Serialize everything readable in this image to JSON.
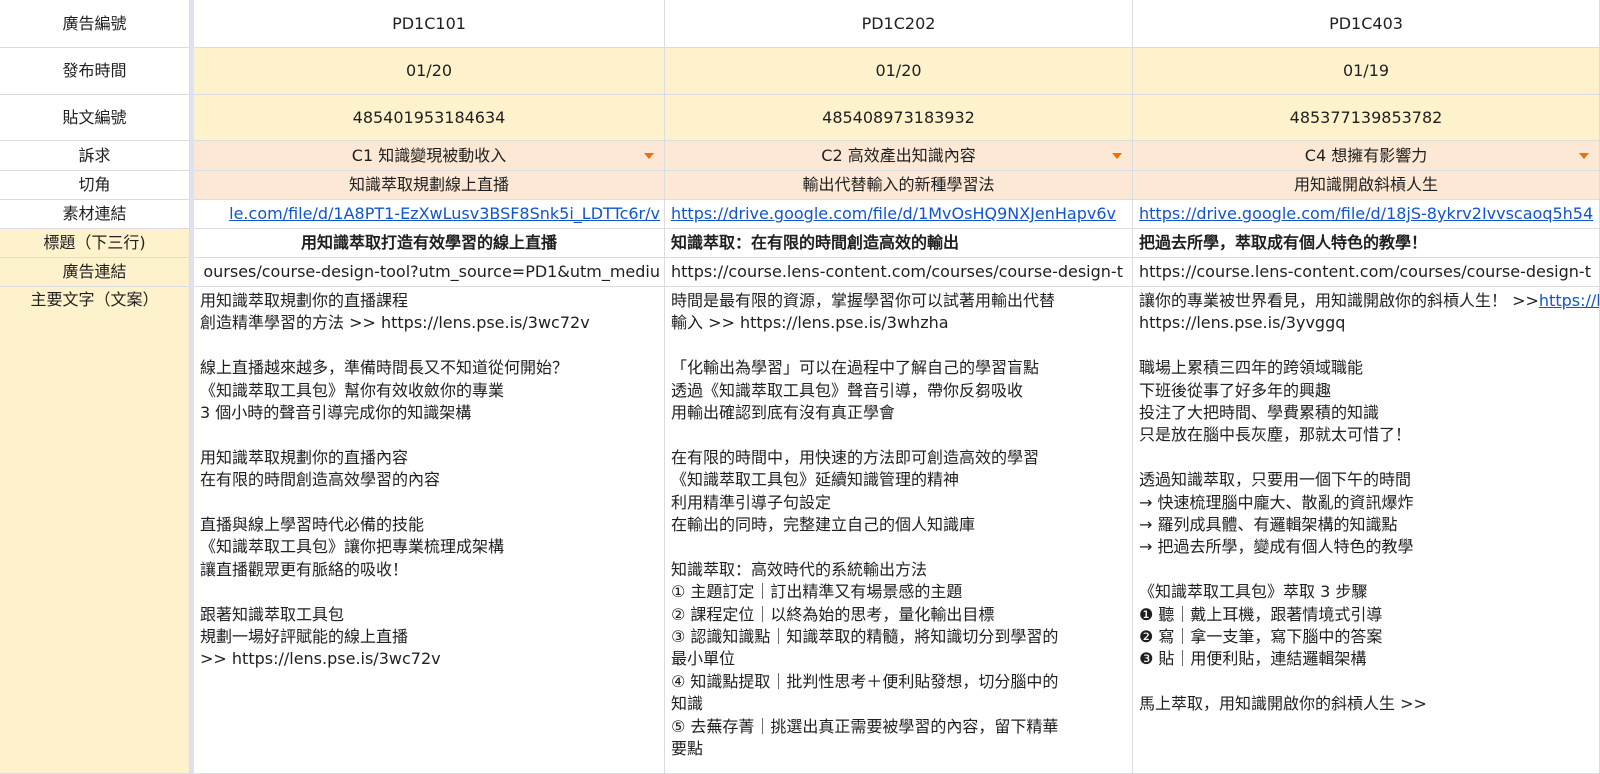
{
  "row_labels": {
    "ad_id": "廣告編號",
    "publish_time": "發布時間",
    "post_id": "貼文編號",
    "appeal": "訴求",
    "angle": "切角",
    "material_link": "素材連結",
    "title": "標題（下三行)",
    "ad_link": "廣告連結",
    "main_text": "主要文字（文案）"
  },
  "ads": [
    {
      "ad_id": "PD1C101",
      "publish_time": "01/20",
      "post_id": "485401953184634",
      "appeal": "C1 知識變現被動收入",
      "angle": "知識萃取規劃線上直播",
      "material_link": "le.com/file/d/1A8PT1-EzXwLusv3BSF8Snk5i_LDTTc6r/v",
      "title": "用知識萃取打造有效學習的線上直播",
      "ad_link": "ourses/course-design-tool?utm_source=PD1&utm_mediu",
      "main_text": [
        "用知識萃取規劃你的直播課程",
        "創造精準學習的方法 >> https://lens.pse.is/3wc72v",
        "",
        "線上直播越來越多，準備時間長又不知道從何開始？",
        "《知識萃取工具包》幫你有效收斂你的專業",
        "3 個小時的聲音引導完成你的知識架構",
        "",
        "用知識萃取規劃你的直播內容",
        "在有限的時間創造高效學習的內容",
        "",
        "直播與線上學習時代必備的技能",
        "《知識萃取工具包》讓你把專業梳理成架構",
        "讓直播觀眾更有脈絡的吸收！",
        "",
        "跟著知識萃取工具包",
        "規劃一場好評賦能的線上直播",
        ">> https://lens.pse.is/3wc72v"
      ]
    },
    {
      "ad_id": "PD1C202",
      "publish_time": "01/20",
      "post_id": "485408973183932",
      "appeal": "C2 高效產出知識內容",
      "angle": "輸出代替輸入的新種學習法",
      "material_link": "https://drive.google.com/file/d/1MvOsHQ9NXJenHapv6v",
      "title": "知識萃取：在有限的時間創造高效的輸出",
      "ad_link": "https://course.lens-content.com/courses/course-design-t",
      "main_text": [
        "時間是最有限的資源，掌握學習你可以試著用輸出代替",
        "輸入 >> https://lens.pse.is/3whzha",
        "",
        "「化輸出為學習」可以在過程中了解自己的學習盲點",
        "透過《知識萃取工具包》聲音引導，帶你反芻吸收",
        "用輸出確認到底有沒有真正學會",
        "",
        "在有限的時間中，用快速的方法即可創造高效的學習",
        "《知識萃取工具包》延續知識管理的精神",
        "利用精準引導子句設定",
        "在輸出的同時，完整建立自己的個人知識庫",
        "",
        "知識萃取：高效時代的系統輸出方法",
        "① 主題訂定｜訂出精準又有場景感的主題",
        "② 課程定位｜以終為始的思考，量化輸出目標",
        "③ 認識知識點｜知識萃取的精髓，將知識切分到學習的",
        "最小單位",
        "④ 知識點提取｜批判性思考＋便利貼發想，切分腦中的",
        "知識",
        "⑤ 去蕪存菁｜挑選出真正需要被學習的內容，留下精華",
        "要點"
      ]
    },
    {
      "ad_id": "PD1C403",
      "publish_time": "01/19",
      "post_id": "485377139853782",
      "appeal": "C4 想擁有影響力",
      "angle": "用知識開啟斜槓人生",
      "material_link": "https://drive.google.com/file/d/18jS-8ykrv2Ivvscaoq5h54",
      "title": "把過去所學，萃取成有個人特色的教學！",
      "ad_link": "https://course.lens-content.com/courses/course-design-t",
      "main_text": [
        "讓你的專業被世界看見，用知識開啟你的斜槓人生！ >>",
        "https://lens.pse.is/3yvggq",
        "",
        "職場上累積三四年的跨領域職能",
        "下班後從事了好多年的興趣",
        "投注了大把時間、學費累積的知識",
        "只是放在腦中長灰塵，那就太可惜了！",
        "",
        "透過知識萃取，只要用一個下午的時間",
        "→ 快速梳理腦中龐大、散亂的資訊爆炸",
        "→ 羅列成具體、有邏輯架構的知識點",
        "→ 把過去所學，變成有個人特色的教學",
        "",
        "《知識萃取工具包》萃取 3 步驟",
        "❶ 聽｜戴上耳機，跟著情境式引導",
        "❷ 寫｜拿一支筆，寫下腦中的答案",
        "❸ 貼｜用便利貼，連結邏輯架構",
        "",
        "馬上萃取，用知識開啟你的斜槓人生 >>"
      ],
      "main_text_link": "https://lens.pse.is/3yvggq"
    }
  ]
}
